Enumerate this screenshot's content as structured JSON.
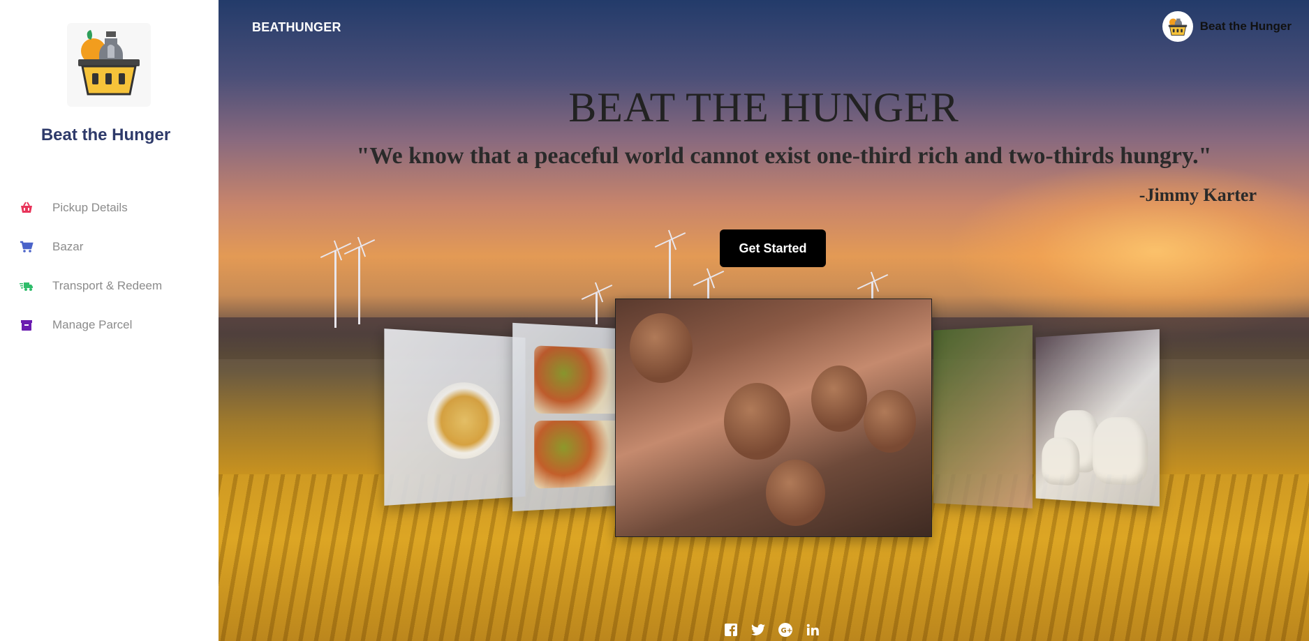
{
  "sidebar": {
    "brand": "Beat the Hunger",
    "items": [
      {
        "label": "Pickup Details",
        "icon": "basket-icon",
        "color": "#e8345a"
      },
      {
        "label": "Bazar",
        "icon": "cart-icon",
        "color": "#4a63c9"
      },
      {
        "label": "Transport & Redeem",
        "icon": "truck-icon",
        "color": "#2ebc6a"
      },
      {
        "label": "Manage Parcel",
        "icon": "parcel-icon",
        "color": "#6a1bb0"
      }
    ]
  },
  "header": {
    "brand": "BEATHUNGER",
    "profile_name": "Beat the Hunger"
  },
  "hero": {
    "title": "BEAT THE HUNGER",
    "quote": "\"We know that a peaceful world cannot exist one-third rich and two-thirds hungry.\"",
    "author": "-Jimmy Karter",
    "cta_label": "Get Started"
  },
  "carousel": {
    "slides": [
      {
        "name": "cereal-bowl-image"
      },
      {
        "name": "meal-prep-image"
      },
      {
        "name": "children-smiling-image"
      },
      {
        "name": "joined-hands-image"
      },
      {
        "name": "food-bags-image"
      }
    ]
  },
  "footer": {
    "socials": [
      "facebook-icon",
      "twitter-icon",
      "google-plus-icon",
      "linkedin-icon"
    ]
  },
  "colors": {
    "brand_text": "#2e3a6a",
    "cta_bg": "#000000",
    "logo_orange": "#f29d1e",
    "logo_yellow": "#f6c33a"
  }
}
